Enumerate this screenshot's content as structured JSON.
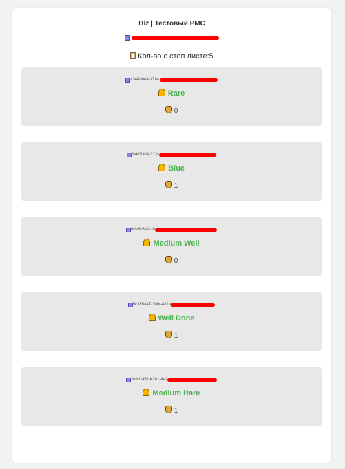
{
  "header": {
    "title": "Biz | Тестовый РМС",
    "stop_list_label": "Кол-во с стоп листе:5"
  },
  "items": [
    {
      "id_prefix": "c344dee4-37fe-",
      "name": "Rare",
      "count": "0"
    },
    {
      "id_prefix": "f04d5384-212c",
      "name": "Blue",
      "count": "1"
    },
    {
      "id_prefix": "bda3b3e1-c8",
      "name": "Medium Well",
      "count": "0"
    },
    {
      "id_prefix": "5c376a47-30bf-432a",
      "name": "Well Done",
      "count": "1"
    },
    {
      "id_prefix": "2e9dc451-b201-4e1",
      "name": "Medium Rare",
      "count": "1"
    }
  ],
  "colors": {
    "accent_green": "#4caf50",
    "redaction": "#ff0000",
    "item_background": "#e8e8e8"
  },
  "icons": {
    "id_marker": "purple-square-icon",
    "stop_list": "clipboard-icon",
    "status": "bell-icon",
    "count": "money-bag-icon"
  }
}
